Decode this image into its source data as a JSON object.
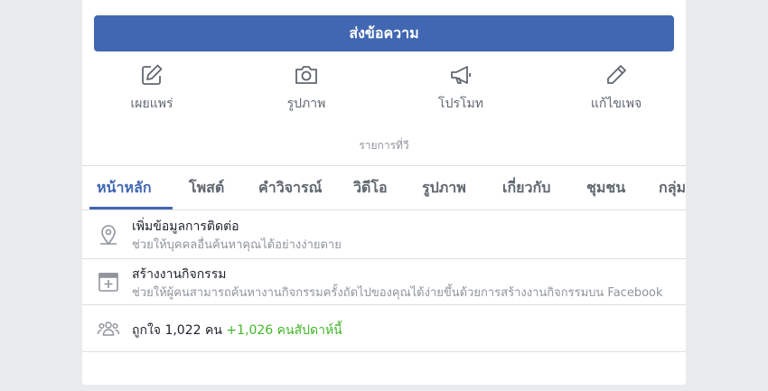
{
  "header": {
    "message_button": "ส่งข้อความ"
  },
  "actions": [
    {
      "label": "เผยแพร่",
      "icon": "edit-icon"
    },
    {
      "label": "รูปภาพ",
      "icon": "camera-icon"
    },
    {
      "label": "โปรโมท",
      "icon": "megaphone-icon"
    },
    {
      "label": "แก้ไขเพจ",
      "icon": "pencil-icon"
    }
  ],
  "recommend_text": "รายการที่วี",
  "tabs": [
    {
      "label": "หน้าหลัก",
      "active": true
    },
    {
      "label": "โพสต์"
    },
    {
      "label": "คำวิจารณ์"
    },
    {
      "label": "วิดีโอ"
    },
    {
      "label": "รูปภาพ"
    },
    {
      "label": "เกี่ยวกับ"
    },
    {
      "label": "ชุมชน"
    },
    {
      "label": "กลุ่ม"
    }
  ],
  "rows": {
    "contact": {
      "title": "เพิ่มข้อมูลการติดต่อ",
      "subtitle": "ช่วยให้บุคคลอื่นค้นหาคุณได้อย่างง่ายดาย",
      "icon": "location-pin-icon"
    },
    "event": {
      "title": "สร้างงานกิจกรรม",
      "subtitle": "ช่วยให้ผู้คนสามารถค้นหางานกิจกรรมครั้งถัดไปของคุณได้ง่ายขึ้นด้วยการสร้างงานกิจกรรมบน Facebook",
      "icon": "calendar-add-icon"
    },
    "likes": {
      "text": "ถูกใจ 1,022 คน",
      "gain": "+1,026 คนสัปดาห์นี้",
      "icon": "people-icon"
    }
  },
  "colors": {
    "brand_blue": "#4267b2",
    "gain_green": "#42b72a"
  }
}
